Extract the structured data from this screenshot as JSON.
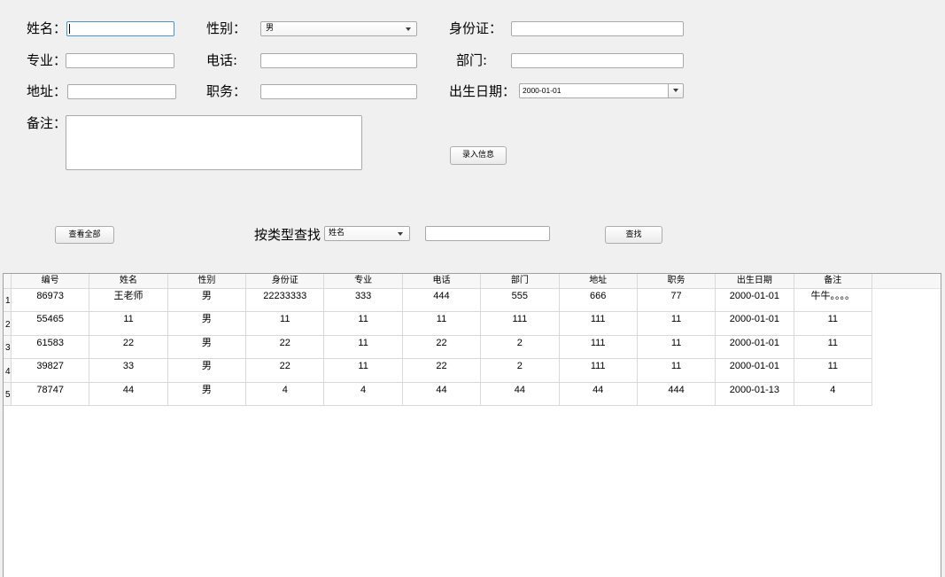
{
  "theme": {
    "focus_border": "#4a90e2"
  },
  "form": {
    "name_label": "姓名：",
    "gender_label": "性别：",
    "gender_value": "男",
    "id_card_label": "身份证：",
    "major_label": "专业：",
    "phone_label": "电话:",
    "department_label": "部门:",
    "address_label": "地址：",
    "position_label": "职务：",
    "birth_date_label": "出生日期：",
    "birth_date_value": "2000-01-01",
    "remark_label": "备注：",
    "submit_button": "录入信息"
  },
  "search": {
    "show_all_button": "查看全部",
    "search_type_label": "按类型查找",
    "search_type_value": "姓名",
    "search_button": "查找"
  },
  "table": {
    "headers": [
      "编号",
      "姓名",
      "性别",
      "身份证",
      "专业",
      "电话",
      "部门",
      "地址",
      "职务",
      "出生日期",
      "备注"
    ],
    "row_numbers": [
      "1",
      "2",
      "3",
      "4",
      "5"
    ],
    "rows": [
      [
        "86973",
        "王老师",
        "男",
        "22233333",
        "333",
        "444",
        "555",
        "666",
        "77",
        "2000-01-01",
        "牛牛。。。。"
      ],
      [
        "55465",
        "11",
        "男",
        "11",
        "11",
        "11",
        "111",
        "111",
        "11",
        "2000-01-01",
        "11"
      ],
      [
        "61583",
        "22",
        "男",
        "22",
        "11",
        "22",
        "2",
        "111",
        "11",
        "2000-01-01",
        "11"
      ],
      [
        "39827",
        "33",
        "男",
        "22",
        "11",
        "22",
        "2",
        "111",
        "11",
        "2000-01-01",
        "11"
      ],
      [
        "78747",
        "44",
        "男",
        "4",
        "4",
        "44",
        "44",
        "44",
        "444",
        "2000-01-13",
        "4"
      ]
    ]
  }
}
